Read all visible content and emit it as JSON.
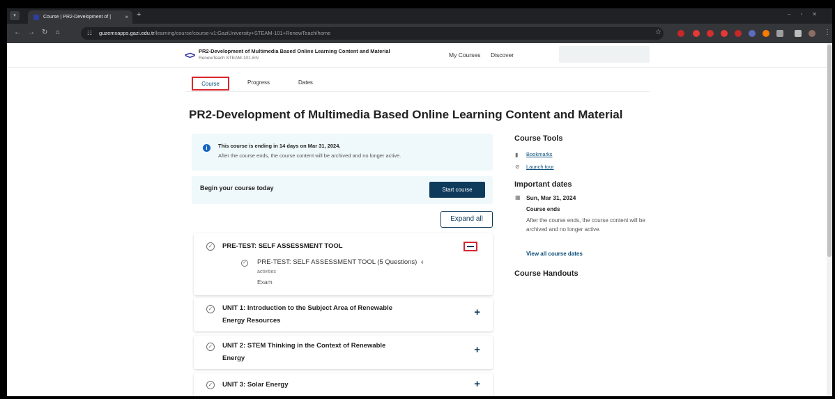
{
  "browser": {
    "tab_title": "Course | PR2-Development of | ",
    "tab_close": "×",
    "new_tab": "+",
    "url_host": "guzemxapps.gazi.edu.tr",
    "url_path": "/learning/course/course-v1:GaziUniversity+STEAM-101+RenewTeach/home"
  },
  "header": {
    "logo": "<>",
    "course_title": "PR2-Development of Multimedia Based Online Learning Content and Material",
    "course_subtitle": "RenewTeach STEAM-101-EN",
    "nav": [
      "My Courses",
      "Discover"
    ]
  },
  "tabs": [
    {
      "label": "Course",
      "active": true
    },
    {
      "label": "Progress",
      "active": false
    },
    {
      "label": "Dates",
      "active": false
    }
  ],
  "page_title": "PR2-Development of Multimedia Based Online Learning Content and Material",
  "alert": {
    "line1": "This course is ending in 14 days on Mar 31, 2024.",
    "line2": "After the course ends, the course content will be archived and no longer active."
  },
  "begin": {
    "label": "Begin your course today",
    "button": "Start course"
  },
  "expand_all": "Expand all",
  "sections": [
    {
      "title": "PRE-TEST: SELF ASSESSMENT TOOL",
      "expanded": true,
      "subsection": {
        "title": "PRE-TEST: SELF ASSESSMENT TOOL (5 Questions)",
        "count": "4",
        "count_unit": "activities",
        "type": "Exam"
      }
    },
    {
      "title_line1": "UNIT 1: Introduction to the Subject Area of Renewable",
      "title_line2": "Energy Resources"
    },
    {
      "title_line1": "UNIT 2: STEM Thinking in the Context of Renewable",
      "title_line2": "Energy"
    },
    {
      "title_line1": "UNIT 3: Solar Energy",
      "title_line2": ""
    }
  ],
  "sidebar": {
    "tools_heading": "Course Tools",
    "bookmarks": "Bookmarks",
    "launch_tour": "Launch tour",
    "dates_heading": "Important dates",
    "date": "Sun, Mar 31, 2024",
    "ends_label": "Course ends",
    "ends_desc": "After the course ends, the course content will be archived and no longer active.",
    "view_all": "View all course dates",
    "handouts_heading": "Course Handouts"
  }
}
